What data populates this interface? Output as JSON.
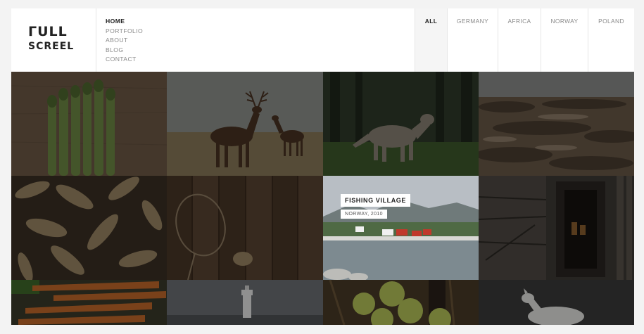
{
  "brand": {
    "line1": "ΓULL",
    "line2": "SCREEL"
  },
  "nav": {
    "items": [
      {
        "label": "HOME",
        "active": true
      },
      {
        "label": "PORTFOLIO",
        "active": false
      },
      {
        "label": "ABOUT",
        "active": false
      },
      {
        "label": "BLOG",
        "active": false
      },
      {
        "label": "CONTACT",
        "active": false
      }
    ]
  },
  "filters": {
    "items": [
      {
        "label": "ALL",
        "active": true
      },
      {
        "label": "GERMANY",
        "active": false
      },
      {
        "label": "AFRICA",
        "active": false
      },
      {
        "label": "NORWAY",
        "active": false
      },
      {
        "label": "POLAND",
        "active": false
      }
    ]
  },
  "featured": {
    "title": "FISHING VILLAGE",
    "subtitle": "NORWAY, 2010"
  },
  "colors": {
    "accent": "#222222",
    "muted": "#8a8a8a",
    "divider": "#e6e6e6"
  },
  "gallery": [
    {
      "subject": "asparagus"
    },
    {
      "subject": "deer"
    },
    {
      "subject": "wolf"
    },
    {
      "subject": "rocky-coast"
    },
    {
      "subject": "dried-leaves"
    },
    {
      "subject": "wooden-wall"
    },
    {
      "subject": "fishing-village"
    },
    {
      "subject": "old-shack"
    },
    {
      "subject": "carrots"
    },
    {
      "subject": "lighthouse"
    },
    {
      "subject": "apples"
    },
    {
      "subject": "white-wolf"
    }
  ]
}
